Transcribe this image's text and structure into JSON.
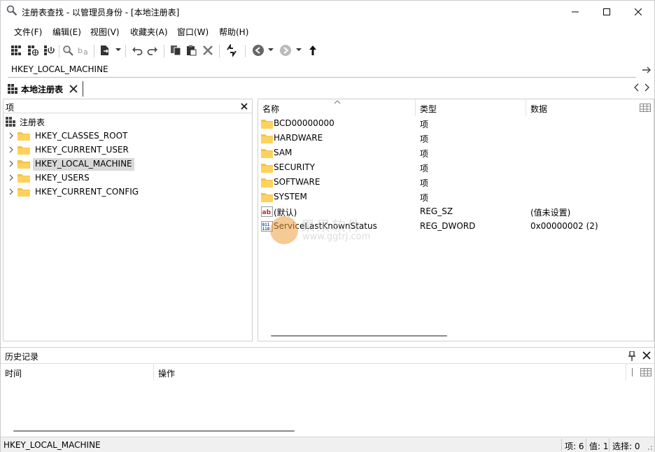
{
  "window": {
    "title": "注册表查找 - 以管理员身份 - [本地注册表]",
    "controls": [
      "minimize-icon",
      "maximize-icon",
      "close-icon"
    ]
  },
  "menu": {
    "items": [
      "文件(F)",
      "编辑(E)",
      "视图(V)",
      "收藏夹(A)",
      "窗口(W)",
      "帮助(H)"
    ]
  },
  "toolbar": {
    "icons": [
      "local-registry-icon",
      "network-registry-icon",
      "disconnect-icon",
      "find-icon",
      "find-replace-icon",
      "export-icon",
      "undo-icon",
      "redo-icon",
      "copy-icon",
      "paste-icon",
      "delete-icon",
      "refresh-icon",
      "back-icon",
      "forward-icon",
      "up-icon"
    ]
  },
  "address": {
    "value": "HKEY_LOCAL_MACHINE"
  },
  "tabs": [
    {
      "label": "本地注册表"
    }
  ],
  "tree": {
    "header": "项",
    "root": "注册表",
    "nodes": [
      {
        "label": "HKEY_CLASSES_ROOT",
        "selected": false
      },
      {
        "label": "HKEY_CURRENT_USER",
        "selected": false
      },
      {
        "label": "HKEY_LOCAL_MACHINE",
        "selected": true
      },
      {
        "label": "HKEY_USERS",
        "selected": false
      },
      {
        "label": "HKEY_CURRENT_CONFIG",
        "selected": false
      }
    ]
  },
  "list": {
    "columns": [
      "名称",
      "类型",
      "数据"
    ],
    "rows": [
      {
        "icon": "folder-icon",
        "name": "BCD00000000",
        "type": "项",
        "data": ""
      },
      {
        "icon": "folder-icon",
        "name": "HARDWARE",
        "type": "项",
        "data": ""
      },
      {
        "icon": "folder-icon",
        "name": "SAM",
        "type": "项",
        "data": ""
      },
      {
        "icon": "folder-icon",
        "name": "SECURITY",
        "type": "项",
        "data": ""
      },
      {
        "icon": "folder-icon",
        "name": "SOFTWARE",
        "type": "项",
        "data": ""
      },
      {
        "icon": "folder-icon",
        "name": "SYSTEM",
        "type": "项",
        "data": ""
      },
      {
        "icon": "string-value-icon",
        "name": "(默认)",
        "type": "REG_SZ",
        "data": "(值未设置)"
      },
      {
        "icon": "binary-value-icon",
        "name": "ServiceLastKnownStatus",
        "type": "REG_DWORD",
        "data": "0x00000002 (2)"
      }
    ]
  },
  "watermark": {
    "text": "果果软件",
    "url": "www.ggtrj.com"
  },
  "history": {
    "title": "历史记录",
    "columns": [
      "时间",
      "操作"
    ]
  },
  "status": {
    "path": "HKEY_LOCAL_MACHINE",
    "items": "项: 6",
    "values": "值: 1",
    "selection": "选择: 0"
  }
}
